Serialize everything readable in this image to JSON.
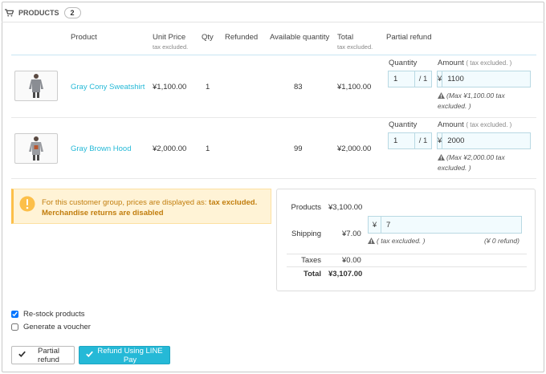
{
  "panel": {
    "title": "Products",
    "count": "2"
  },
  "columns": {
    "product": "Product",
    "unit_price": "Unit Price",
    "unit_price_sub": "tax excluded.",
    "qty": "Qty",
    "refunded": "Refunded",
    "available_quantity": "Available quantity",
    "total": "Total",
    "total_sub": "tax excluded.",
    "partial_refund": "Partial refund"
  },
  "refund_labels": {
    "quantity": "Quantity",
    "amount": "Amount",
    "amount_sub": "( tax excluded. )",
    "currency": "¥"
  },
  "products": [
    {
      "name": "Gray Cony Sweatshirt",
      "unit_price": "¥1,100.00",
      "qty": "1",
      "available": "83",
      "total": "¥1,100.00",
      "refund_qty": "1",
      "refund_qty_max": "/ 1",
      "refund_amount": "1100",
      "max_note": "(Max ¥1,100.00 tax excluded. )"
    },
    {
      "name": "Gray Brown Hood",
      "unit_price": "¥2,000.00",
      "qty": "1",
      "available": "99",
      "total": "¥2,000.00",
      "refund_qty": "1",
      "refund_qty_max": "/ 1",
      "refund_amount": "2000",
      "max_note": "(Max ¥2,000.00 tax excluded. )"
    }
  ],
  "alert": {
    "line1_prefix": "For this customer group, prices are displayed as:",
    "line1_strong": "tax excluded.",
    "line2": "Merchandise returns are disabled"
  },
  "summary": {
    "products_label": "Products",
    "products_value": "¥3,100.00",
    "shipping_label": "Shipping",
    "shipping_value": "¥7.00",
    "shipping_currency": "¥",
    "shipping_input": "7",
    "shipping_note": "( tax excluded. )",
    "shipping_refund_note": "(¥ 0 refund)",
    "taxes_label": "Taxes",
    "taxes_value": "¥0.00",
    "total_label": "Total",
    "total_value": "¥3,107.00"
  },
  "options": {
    "restock_label": "Re-stock products",
    "restock_checked": true,
    "voucher_label": "Generate a voucher",
    "voucher_checked": false
  },
  "buttons": {
    "partial_refund": "Partial refund",
    "refund_line_pay": "Refund Using LINE Pay"
  },
  "colors": {
    "accent": "#25b9d7",
    "warning_bg": "#fff3d6",
    "warning_text": "#c17d0d"
  }
}
